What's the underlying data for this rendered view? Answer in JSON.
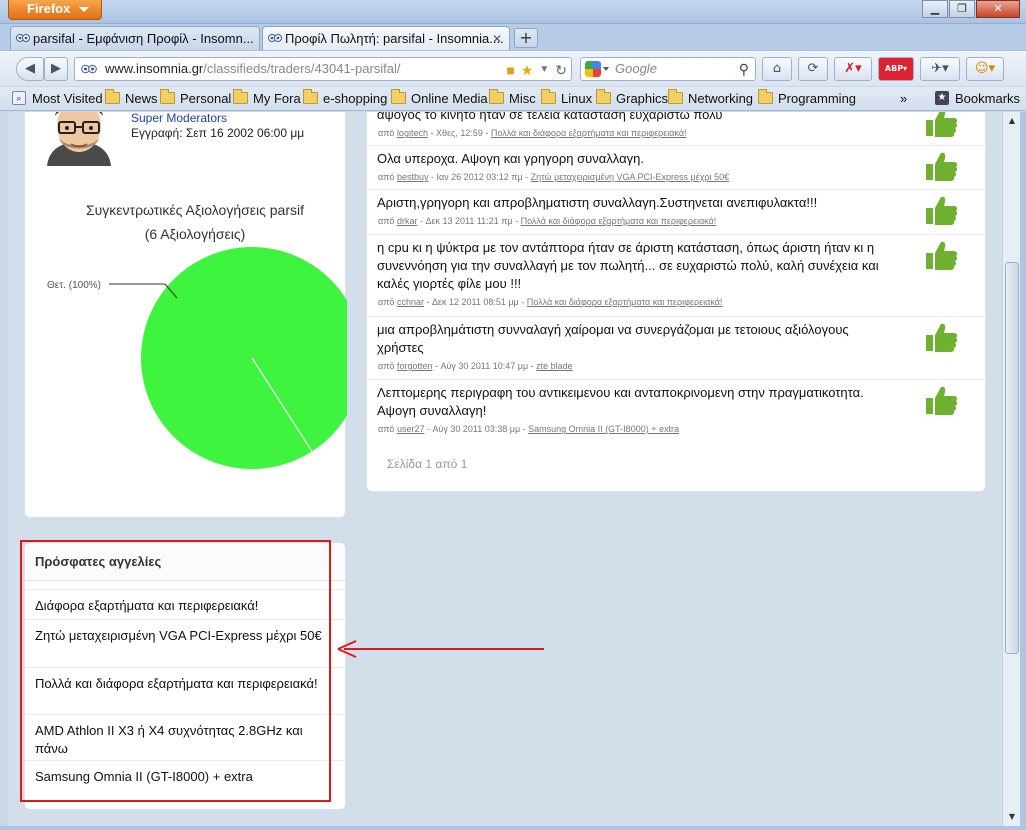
{
  "browser": {
    "app_button": "Firefox",
    "tabs": [
      {
        "title": "parsifal - Εμφάνιση Προφίλ - Insomn...",
        "active": false
      },
      {
        "title": "Προφίλ Πωλητή: parsifal - Insomnia....",
        "active": true
      }
    ],
    "url": {
      "host": "www.insomnia.gr",
      "path": "/classifieds/traders/43041-parsifal/"
    },
    "search_placeholder": "Google",
    "bookmarks": [
      "Most Visited",
      "News",
      "Personal",
      "My Fora",
      "e-shopping",
      "Online Media",
      "Misc",
      "Linux",
      "Graphics",
      "Networking",
      "Programming"
    ],
    "bookmarks_menu": "Bookmarks",
    "overflow": "»"
  },
  "profile": {
    "name": "parsifal",
    "role": "Super Moderators",
    "joined": "Εγγραφή: Σεπ 16 2002 06:00 μμ"
  },
  "chart_data": {
    "type": "pie",
    "title": "Συγκεντρωτικές Αξιολογήσεις  parsif",
    "subtitle": "(6 Αξιολογήσεις)",
    "slices": [
      {
        "label": "Θετ. (100%)",
        "value": 100,
        "color": "#3ef43e"
      }
    ]
  },
  "reviews": [
    {
      "text": "αψογος το κινητο ηταν σε τελεια κατασταση ευχαριστω πολυ",
      "meta_prefix": "από",
      "user": "logitech",
      "date": "Χθες, 12:59",
      "item": "Πολλά και διάφορα εξαρτήματα και περιφερειακά!"
    },
    {
      "text": "Ολα υπεροχα. Αψογη και γρηγορη συναλλαγη.",
      "meta_prefix": "από",
      "user": "bestbuy",
      "date": "Ιαν 26 2012 03:12 πμ",
      "item": "Ζητώ μεταχειρισμένη VGA PCI-Express μέχρι 50€"
    },
    {
      "text": "Αριστη,γρηγορη και απροβληματιστη συναλλαγη.Συστηνεται ανεπιφυλακτα!!!",
      "meta_prefix": "από",
      "user": "drkar",
      "date": "Δεκ 13 2011 11:21 πμ",
      "item": "Πολλά και διάφορα εξαρτήματα και περιφερειακά!"
    },
    {
      "text": "η cpu κι η ψύκτρα με τον αντάπτορα ήταν σε άριστη κατάσταση, όπως άριστη ήταν κι η συνεννόηση για την συναλλαγή με τον πωλητή... σε ευχαριστώ πολύ, καλή συνέχεια και καλές γιορτές φίλε μου !!!",
      "meta_prefix": "από",
      "user": "cchnar",
      "date": "Δεκ 12 2011 08:51 μμ",
      "item": "Πολλά και διάφορα εξαρτήματα και περιφερειακά!"
    },
    {
      "text": "μια απροβλημάτιστη συνναλαγή χαίρομαι να συνεργάζομαι με τετοιους αξιόλογους χρήστες",
      "meta_prefix": "από",
      "user": "forgotten",
      "date": "Αύγ 30 2011 10:47 μμ",
      "item": "zte blade"
    },
    {
      "text": "Λεπτομερης περιγραφη του αντικειμενου και ανταποκρινομενη στην πραγματικοτητα. Αψογη συναλλαγη!",
      "meta_prefix": "από",
      "user": "user27",
      "date": "Αύγ 30 2011 03:38 μμ",
      "item": "Samsung Omnia II (GT-I8000) + extra"
    }
  ],
  "pagination": "Σελίδα 1 από 1",
  "recent": {
    "title": "Πρόσφατες αγγελίες",
    "items": [
      "Διάφορα εξαρτήματα και περιφερειακά!",
      "Ζητώ μεταχειρισμένη VGA PCI-Express μέχρι 50€",
      "Πολλά και διάφορα εξαρτήματα και περιφερειακά!",
      "AMD Athlon II X3 ή X4 συχνότητας 2.8GHz και πάνω",
      "Samsung Omnia II (GT-I8000) + extra"
    ]
  },
  "colors": {
    "positive": "#3ef43e",
    "annotation": "#e01818",
    "thumb": "#6fb030"
  }
}
